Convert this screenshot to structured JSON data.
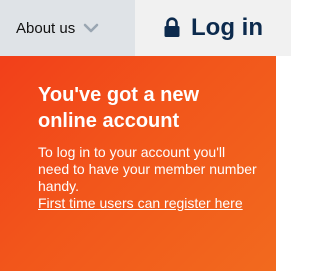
{
  "nav": {
    "about_label": "About us",
    "login_label": "Log in"
  },
  "panel": {
    "heading": "You've got a new online account",
    "body": "To log in to your account you'll need to have your member number handy.",
    "register_link": "First time users can register here"
  },
  "icons": {
    "about_chevron": "chevron-down-icon",
    "login": "lock-icon"
  },
  "colors": {
    "panel_start": "#f23f1a",
    "panel_end": "#f26a1e",
    "login_text": "#0c2a4d",
    "about_bg": "#dfe3e7"
  }
}
